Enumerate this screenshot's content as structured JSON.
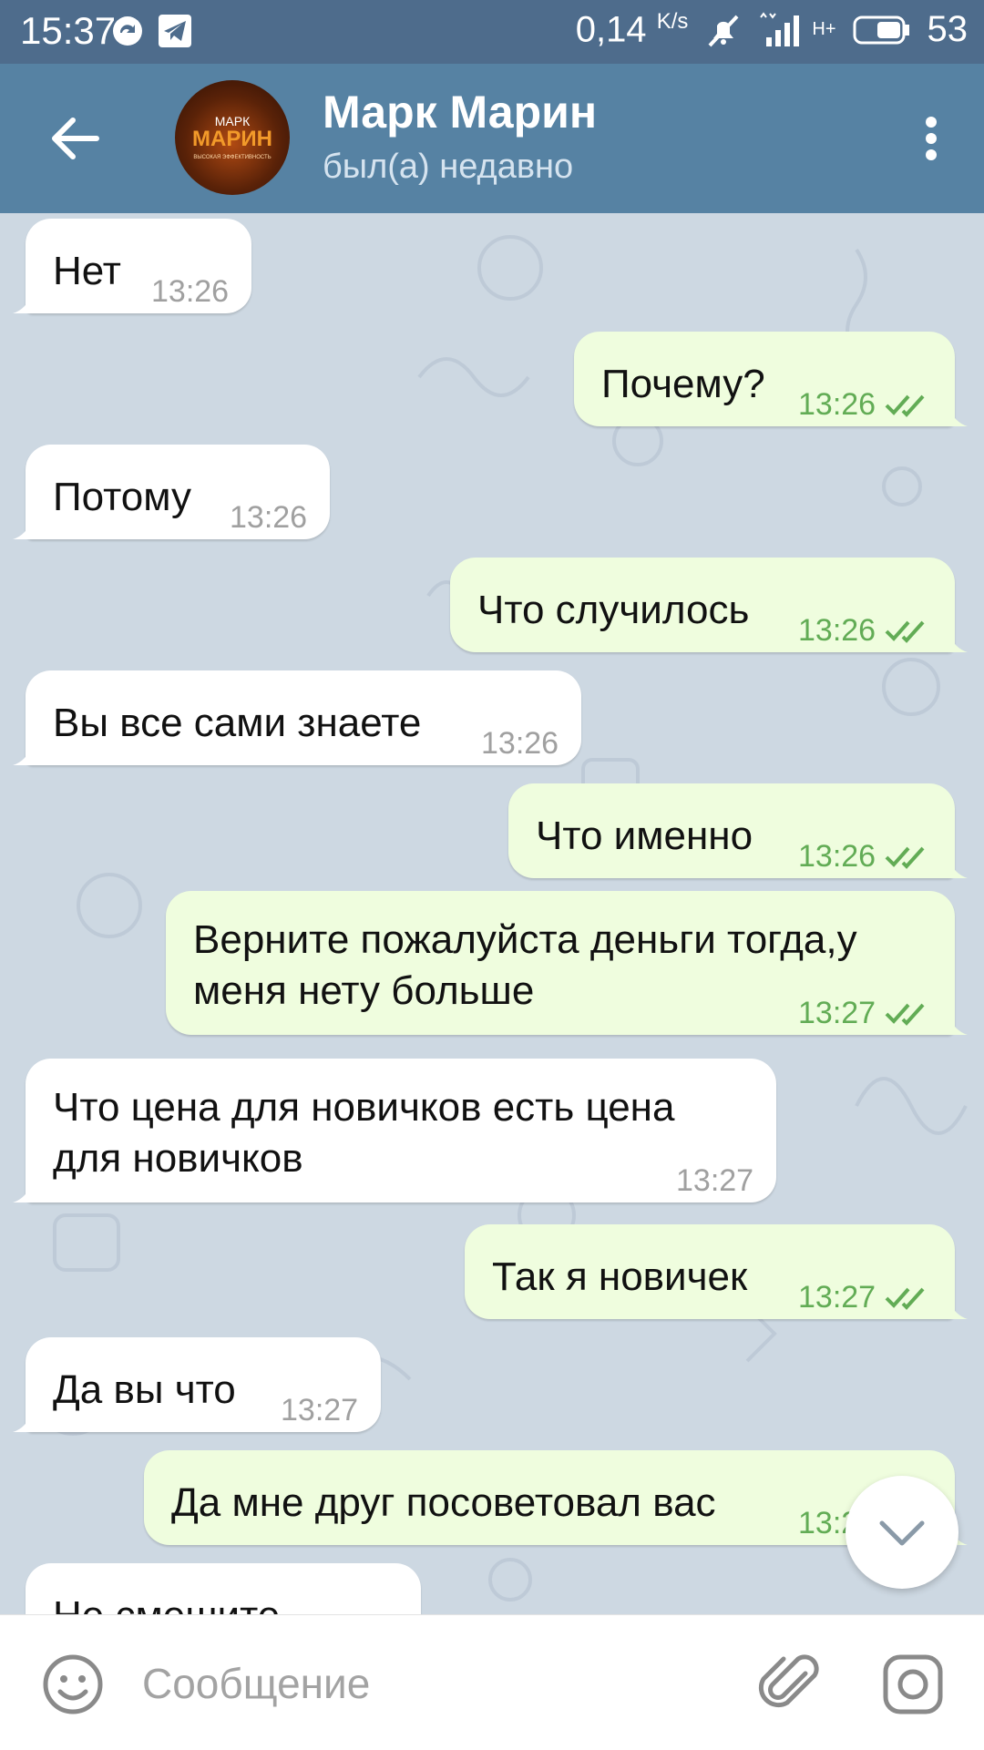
{
  "status_bar": {
    "time": "15:37",
    "network_speed": "0,14",
    "network_unit": "K/s",
    "network_type": "H+",
    "battery": "53",
    "icons": [
      "sync-icon",
      "telegram-icon",
      "mute-icon",
      "signal-icon",
      "battery-icon"
    ]
  },
  "header": {
    "title": "Марк Марин",
    "status": "был(а) недавно",
    "avatar": {
      "line1": "МАРК",
      "line2": "МАРИН",
      "line3": "ВЫСОКАЯ ЭФФЕКТИВНОСТЬ"
    }
  },
  "messages": [
    {
      "dir": "in",
      "text": "Нет",
      "time": "13:26"
    },
    {
      "dir": "out",
      "text": "Почему?",
      "time": "13:26"
    },
    {
      "dir": "in",
      "text": "Потому",
      "time": "13:26"
    },
    {
      "dir": "out",
      "text": "Что случилось",
      "time": "13:26"
    },
    {
      "dir": "in",
      "text": "Вы все сами знаете",
      "time": "13:26"
    },
    {
      "dir": "out",
      "text": "Что именно",
      "time": "13:26"
    },
    {
      "dir": "out",
      "text": "Верните пожалуйста деньги тогда,у",
      "text2": "меня нету больше",
      "time": "13:27"
    },
    {
      "dir": "in",
      "text": "Что цена для новичков есть цена",
      "text2": "для новичков",
      "time": "13:27"
    },
    {
      "dir": "out",
      "text": "Так я новичек",
      "time": "13:27"
    },
    {
      "dir": "in",
      "text": "Да вы что",
      "time": "13:27"
    },
    {
      "dir": "out",
      "text": "Да мне друг посоветовал вас",
      "time": "13:2"
    },
    {
      "dir": "in",
      "text": "Не смешите",
      "time": ""
    }
  ],
  "composer": {
    "placeholder": "Сообщение"
  },
  "colors": {
    "status_bar": "#4e6c8c",
    "header": "#5682a3",
    "chat_background": "#cdd8e2",
    "incoming_bubble": "#ffffff",
    "outgoing_bubble": "#effdde",
    "outgoing_meta": "#62ac55"
  }
}
